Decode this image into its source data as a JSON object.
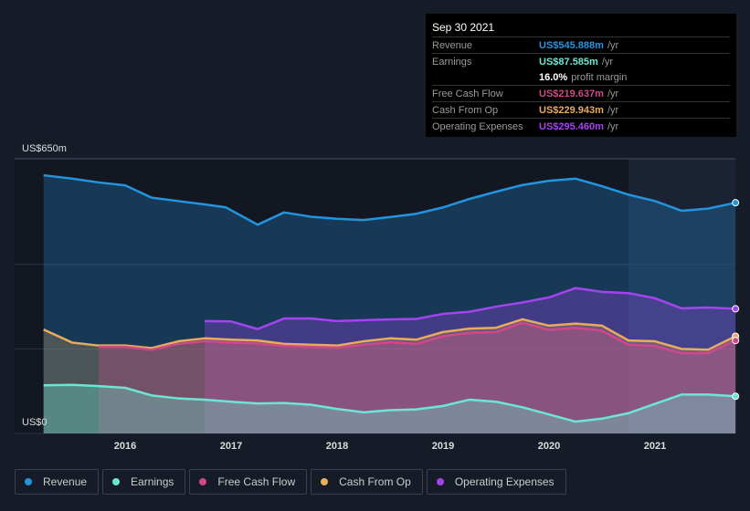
{
  "tooltip": {
    "date": "Sep 30 2021",
    "rows": [
      {
        "label": "Revenue",
        "value": "US$545.888m",
        "unit": "/yr",
        "color": "#2394df"
      },
      {
        "label": "Earnings",
        "value": "US$87.585m",
        "unit": "/yr",
        "color": "#6ce5d4"
      },
      {
        "label": "",
        "value": "16.0%",
        "unit": "profit margin",
        "color": "#ffffff"
      },
      {
        "label": "Free Cash Flow",
        "value": "US$219.637m",
        "unit": "/yr",
        "color": "#d0488a"
      },
      {
        "label": "Cash From Op",
        "value": "US$229.943m",
        "unit": "/yr",
        "color": "#e9ac5c"
      },
      {
        "label": "Operating Expenses",
        "value": "US$295.460m",
        "unit": "/yr",
        "color": "#a444f0"
      }
    ]
  },
  "chart_data": {
    "type": "area",
    "ylim": [
      0,
      650
    ],
    "y_tick_labels": [
      "US$650m",
      "US$0"
    ],
    "x_tick_labels": [
      "2016",
      "2017",
      "2018",
      "2019",
      "2020",
      "2021"
    ],
    "grid": true,
    "legend_placement": "bottom",
    "series": [
      {
        "name": "Revenue",
        "color": "#2394df",
        "x": [
          2015.23,
          2015.5,
          2015.75,
          2016,
          2016.25,
          2016.5,
          2016.75,
          2016.95,
          2017.25,
          2017.5,
          2017.75,
          2018,
          2018.25,
          2018.5,
          2018.75,
          2019,
          2019.25,
          2019.5,
          2019.75,
          2020,
          2020.25,
          2020.5,
          2020.75,
          2021,
          2021.25,
          2021.5,
          2021.76
        ],
        "values": [
          611,
          603,
          594,
          587,
          558,
          550,
          542,
          535,
          494,
          523,
          513,
          508,
          505,
          512,
          520,
          535,
          555,
          572,
          588,
          598,
          603,
          585,
          565,
          550,
          527,
          532,
          546
        ]
      },
      {
        "name": "Operating Expenses",
        "color": "#a444f0",
        "x": [
          2016.75,
          2017,
          2017.25,
          2017.5,
          2017.75,
          2018,
          2018.25,
          2018.5,
          2018.75,
          2019,
          2019.25,
          2019.5,
          2019.75,
          2020,
          2020.25,
          2020.5,
          2020.75,
          2021,
          2021.25,
          2021.5,
          2021.76
        ],
        "values": [
          266,
          265,
          247,
          272,
          272,
          266,
          268,
          270,
          271,
          283,
          288,
          300,
          310,
          322,
          344,
          335,
          332,
          320,
          296,
          298,
          295
        ]
      },
      {
        "name": "Cash From Op",
        "color": "#e9ac5c",
        "x": [
          2015.23,
          2015.5,
          2015.75,
          2016,
          2016.25,
          2016.5,
          2016.75,
          2017,
          2017.25,
          2017.5,
          2017.75,
          2018,
          2018.25,
          2018.5,
          2018.75,
          2019,
          2019.25,
          2019.5,
          2019.75,
          2020,
          2020.25,
          2020.5,
          2020.75,
          2021,
          2021.25,
          2021.5,
          2021.76
        ],
        "values": [
          246,
          215,
          208,
          208,
          202,
          218,
          225,
          222,
          220,
          212,
          210,
          208,
          218,
          225,
          222,
          240,
          248,
          250,
          270,
          255,
          260,
          255,
          220,
          218,
          200,
          198,
          230
        ]
      },
      {
        "name": "Free Cash Flow",
        "color": "#d0488a",
        "x": [
          2015.75,
          2016,
          2016.25,
          2016.5,
          2016.75,
          2017,
          2017.25,
          2017.5,
          2017.75,
          2018,
          2018.25,
          2018.5,
          2018.75,
          2019,
          2019.25,
          2019.5,
          2019.75,
          2020,
          2020.25,
          2020.5,
          2020.75,
          2021,
          2021.25,
          2021.5,
          2021.76
        ],
        "values": [
          205,
          205,
          198,
          212,
          218,
          215,
          213,
          207,
          205,
          203,
          210,
          216,
          212,
          230,
          238,
          240,
          262,
          245,
          250,
          243,
          210,
          207,
          190,
          190,
          220
        ]
      },
      {
        "name": "Earnings",
        "color": "#6ce5d4",
        "x": [
          2015.23,
          2015.5,
          2015.75,
          2016,
          2016.25,
          2016.5,
          2016.75,
          2017,
          2017.25,
          2017.5,
          2017.75,
          2018,
          2018.25,
          2018.5,
          2018.75,
          2019,
          2019.25,
          2019.5,
          2019.75,
          2020,
          2020.25,
          2020.5,
          2020.75,
          2021,
          2021.25,
          2021.5,
          2021.76
        ],
        "values": [
          114,
          115,
          112,
          108,
          90,
          83,
          80,
          75,
          71,
          72,
          68,
          58,
          50,
          55,
          57,
          65,
          80,
          75,
          62,
          45,
          28,
          35,
          48,
          70,
          92,
          92,
          88
        ]
      }
    ]
  },
  "legend": [
    {
      "label": "Revenue",
      "color": "#2394df"
    },
    {
      "label": "Earnings",
      "color": "#6ce5d4"
    },
    {
      "label": "Free Cash Flow",
      "color": "#d0488a"
    },
    {
      "label": "Cash From Op",
      "color": "#e9ac5c"
    },
    {
      "label": "Operating Expenses",
      "color": "#a444f0"
    }
  ]
}
